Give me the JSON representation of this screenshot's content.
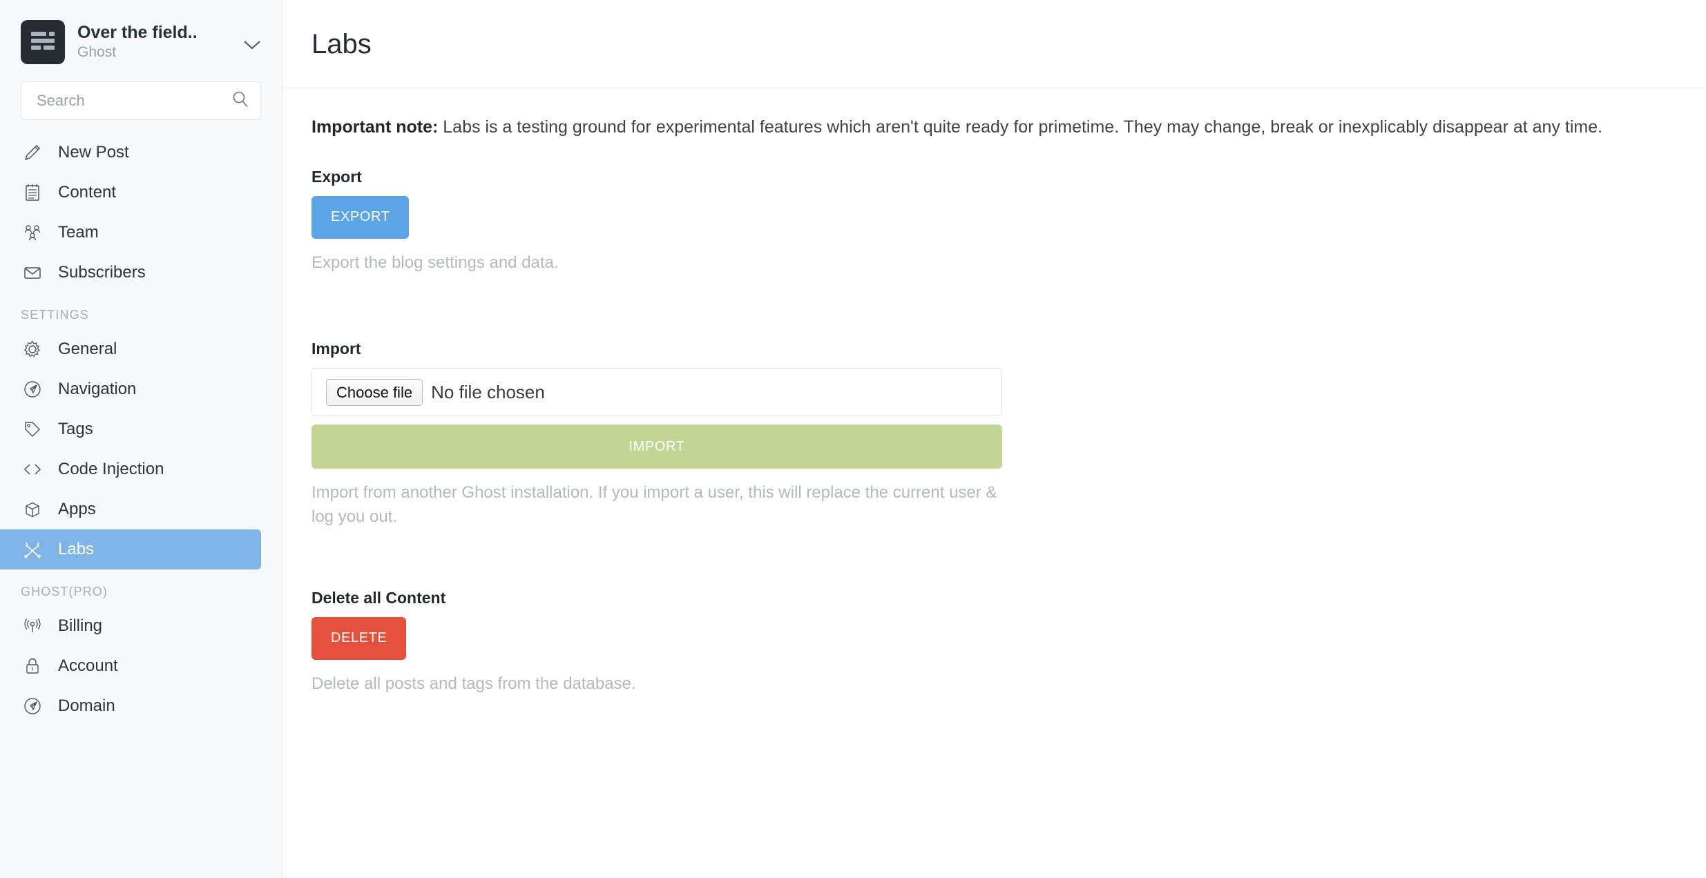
{
  "sidebar": {
    "blog": {
      "title": "Over the field..",
      "subtitle": "Ghost",
      "logo_icon": "blog-logo-icon",
      "chevron_icon": "chevron-down-icon"
    },
    "search": {
      "placeholder": "Search",
      "value": "",
      "icon": "search-icon"
    },
    "primary_items": [
      {
        "label": "New Post",
        "icon": "pencil-icon",
        "active": false
      },
      {
        "label": "Content",
        "icon": "notepad-icon",
        "active": false
      },
      {
        "label": "Team",
        "icon": "users-icon",
        "active": false
      },
      {
        "label": "Subscribers",
        "icon": "envelope-icon",
        "active": false
      }
    ],
    "sections": [
      {
        "label": "SETTINGS",
        "items": [
          {
            "label": "General",
            "icon": "gear-icon",
            "active": false
          },
          {
            "label": "Navigation",
            "icon": "compass-icon",
            "active": false
          },
          {
            "label": "Tags",
            "icon": "tag-icon",
            "active": false
          },
          {
            "label": "Code Injection",
            "icon": "code-icon",
            "active": false
          },
          {
            "label": "Apps",
            "icon": "box-icon",
            "active": false
          },
          {
            "label": "Labs",
            "icon": "wrenches-icon",
            "active": true
          }
        ]
      },
      {
        "label": "GHOST(PRO)",
        "items": [
          {
            "label": "Billing",
            "icon": "broadcast-icon",
            "active": false
          },
          {
            "label": "Account",
            "icon": "lock-icon",
            "active": false
          },
          {
            "label": "Domain",
            "icon": "compass-icon",
            "active": false
          }
        ]
      }
    ]
  },
  "header": {
    "title": "Labs"
  },
  "content": {
    "note_bold": "Important note:",
    "note_text": " Labs is a testing ground for experimental features which aren't quite ready for primetime. They may change, break or inexplicably disappear at any time.",
    "export": {
      "label": "Export",
      "button": "EXPORT",
      "hint": "Export the blog settings and data."
    },
    "import": {
      "label": "Import",
      "choose_file_button": "Choose file",
      "file_name": "No file chosen",
      "button": "IMPORT",
      "hint": "Import from another Ghost installation. If you import a user, this will replace the current user & log you out."
    },
    "delete": {
      "label": "Delete all Content",
      "button": "DELETE",
      "hint": "Delete all posts and tags from the database."
    }
  },
  "colors": {
    "accent_blue": "#5ba4e5",
    "active_nav_blue": "#7eb5e6",
    "import_green": "#c3d592",
    "delete_red": "#e4503c",
    "sidebar_bg": "#f6f8fa",
    "logo_dark": "#272c33"
  }
}
